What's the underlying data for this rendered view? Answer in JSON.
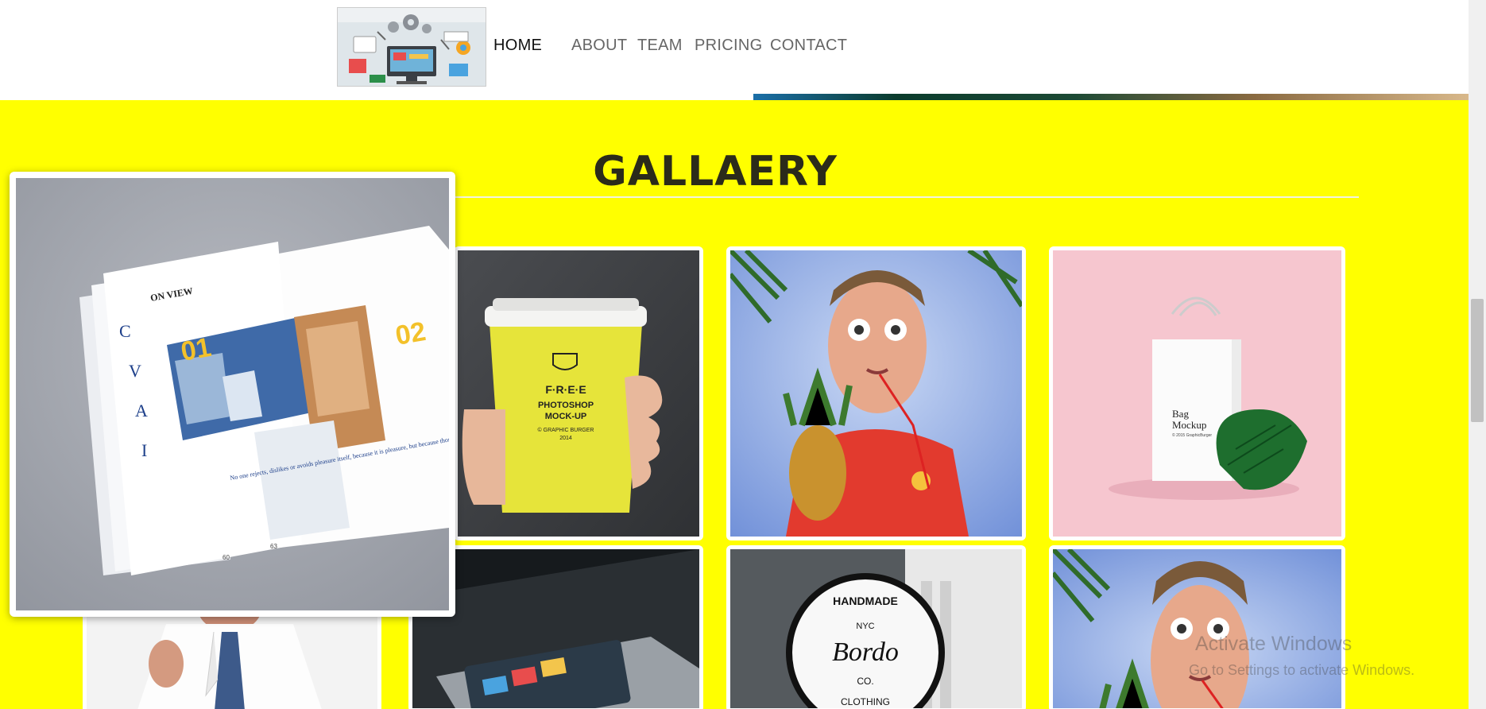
{
  "nav": {
    "items": [
      {
        "label": "HOME",
        "active": true
      },
      {
        "label": "ABOUT"
      },
      {
        "label": "TEAM"
      },
      {
        "label": "PRICING"
      },
      {
        "label": "CONTACT"
      }
    ]
  },
  "section": {
    "title": "GALLAERY"
  },
  "gallery": {
    "zoomed": {
      "name": "magazine-mockup",
      "texts": {
        "heading": "ON VIEW",
        "num1": "01",
        "num2": "02",
        "quote": "No one rejects, dislikes or avoids pleasure itself, because it is pleasure, but because those who do not know",
        "page_left": "60",
        "page_right": "63"
      }
    },
    "cup": {
      "line1": "F·R·E·E",
      "line2": "PHOTOSHOP",
      "line3": "MOCK-UP",
      "line4": "© GRAPHIC BURGER",
      "line5": "2014"
    },
    "bag": {
      "line1": "Bag",
      "line2": "Mockup",
      "line3": "© 2015 GraphicBurger"
    },
    "sign": {
      "line1": "HANDMADE",
      "line2": "NYC",
      "line3": "Bordo",
      "line4": "CO.",
      "line5": "CLOTHING"
    }
  },
  "watermark": {
    "line1": "Activate Windows",
    "line2": "Go to Settings to activate Windows."
  },
  "colors": {
    "section_bg": "#ffff00",
    "header_bg": "#ffffff",
    "title": "#2b2b1a"
  }
}
